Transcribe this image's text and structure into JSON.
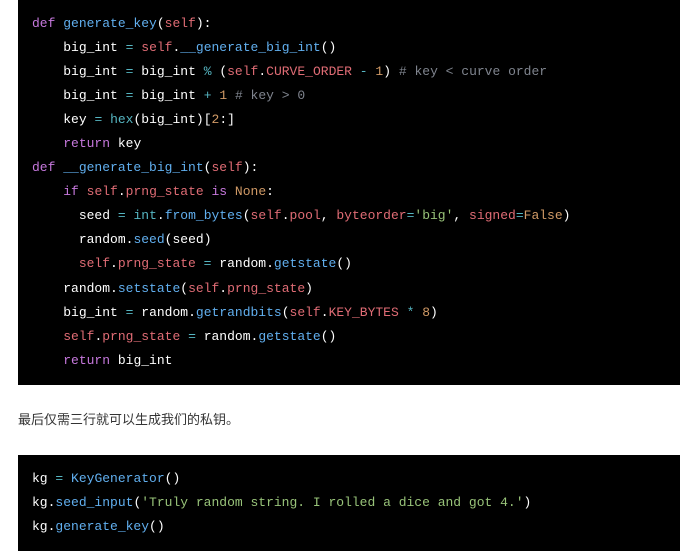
{
  "code1": {
    "l1": {
      "kw": "def",
      "fn": "generate_key",
      "self": "self"
    },
    "l2": {
      "var": "big_int",
      "self": "self",
      "call": "__generate_big_int"
    },
    "l3": {
      "var": "big_int",
      "rhs": "big_int",
      "self": "self",
      "attr": "CURVE_ORDER",
      "one": "1",
      "cmt": "# key < curve order"
    },
    "l4": {
      "var": "big_int",
      "rhs": "big_int",
      "one": "1",
      "cmt": "# key > 0"
    },
    "l5": {
      "var": "key",
      "fn": "hex",
      "arg": "big_int",
      "slice": "2"
    },
    "l6": {
      "kw": "return",
      "var": "key"
    },
    "l7": {
      "kw": "def",
      "fn": "__generate_big_int",
      "self": "self"
    },
    "l8": {
      "kw": "if",
      "self": "self",
      "attr": "prng_state",
      "is": "is",
      "none": "None"
    },
    "l9": {
      "var": "seed",
      "int": "int",
      "from_bytes": "from_bytes",
      "self": "self",
      "pool": "pool",
      "kw_byteorder": "byteorder",
      "big": "'big'",
      "kw_signed": "signed",
      "false": "False"
    },
    "l10": {
      "random": "random",
      "seed": "seed",
      "arg": "seed"
    },
    "l11": {
      "self": "self",
      "attr": "prng_state",
      "random": "random",
      "getstate": "getstate"
    },
    "l12": {
      "random": "random",
      "setstate": "setstate",
      "self": "self",
      "attr": "prng_state"
    },
    "l13": {
      "var": "big_int",
      "random": "random",
      "getrandbits": "getrandbits",
      "self": "self",
      "attr": "KEY_BYTES",
      "eight": "8"
    },
    "l14": {
      "self": "self",
      "attr": "prng_state",
      "random": "random",
      "getstate": "getstate"
    },
    "l15": {
      "kw": "return",
      "var": "big_int"
    }
  },
  "prose_text": "最后仅需三行就可以生成我们的私钥。",
  "code2": {
    "l1": {
      "var": "kg",
      "cls": "KeyGenerator"
    },
    "l2": {
      "var": "kg",
      "method": "seed_input",
      "str": "'Truly random string. I rolled a dice and got 4.'"
    },
    "l3": {
      "var": "kg",
      "method": "generate_key"
    }
  }
}
